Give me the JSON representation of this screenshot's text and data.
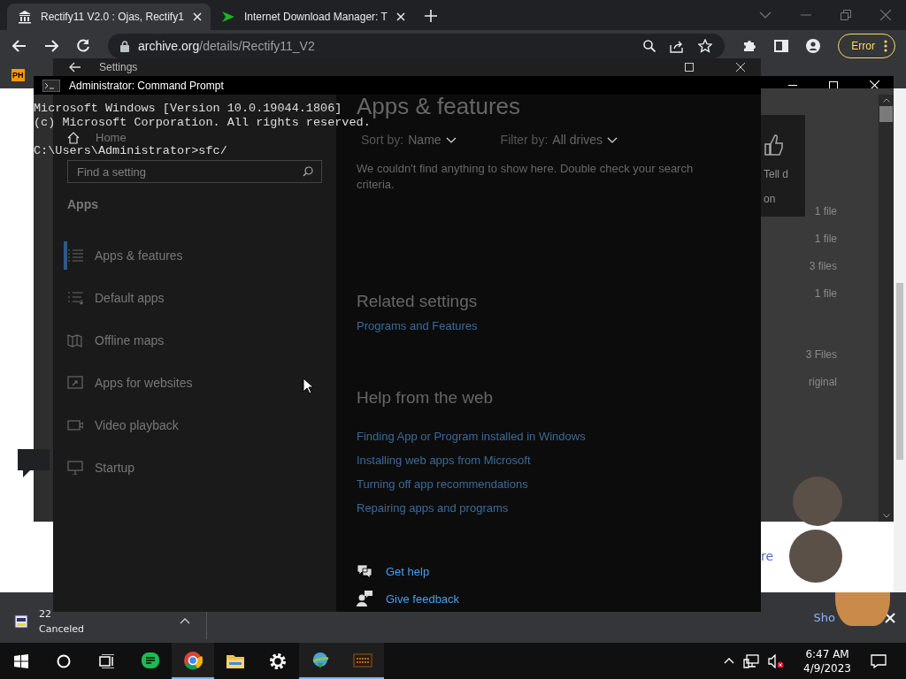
{
  "browser": {
    "tabs": [
      {
        "title": "Rectify11 V2.0 : Ojas, Rectify1",
        "selected": true
      },
      {
        "title": "Internet Download Manager: T",
        "selected": false
      }
    ],
    "address": {
      "host": "archive.org",
      "path": "/details/Rectify11_V2"
    },
    "profile_status": "Error",
    "bookmarks": [
      {
        "label": "PH"
      }
    ],
    "page": {
      "texts": [
        "Tell d",
        "on",
        "1 file",
        "1 file",
        "3 files",
        "1 file",
        "3 Files",
        "riginal",
        "re"
      ]
    },
    "downloads": [
      {
        "name": "22",
        "status": "Canceled"
      }
    ],
    "show_all": "Sho"
  },
  "settings": {
    "title": "Settings",
    "home": "Home",
    "search": {
      "placeholder": "Find a setting"
    },
    "section": "Apps",
    "nav": [
      {
        "label": "Apps & features",
        "selected": true
      },
      {
        "label": "Default apps",
        "selected": false
      },
      {
        "label": "Offline maps",
        "selected": false
      },
      {
        "label": "Apps for websites",
        "selected": false
      },
      {
        "label": "Video playback",
        "selected": false
      },
      {
        "label": "Startup",
        "selected": false
      }
    ],
    "heading": "Apps & features",
    "sort": {
      "label": "Sort by:",
      "value": "Name"
    },
    "filter": {
      "label": "Filter by:",
      "value": "All drives"
    },
    "message": "We couldn't find anything to show here. Double check your search criteria.",
    "related_heading": "Related settings",
    "related_links": [
      "Programs and Features"
    ],
    "help_heading": "Help from the web",
    "help_links": [
      "Finding App or Program installed in Windows",
      "Installing web apps from Microsoft",
      "Turning off app recommendations",
      "Repairing apps and programs"
    ],
    "actions": [
      {
        "label": "Get help"
      },
      {
        "label": "Give feedback"
      }
    ]
  },
  "cmd": {
    "title": "Administrator: Command Prompt",
    "banner": [
      "Microsoft Windows [Version 10.0.19044.1806]",
      "(c) Microsoft Corporation. All rights reserved."
    ],
    "prompt": "C:\\Users\\Administrator>sfc/"
  },
  "taskbar": {
    "apps": [
      {
        "active": false
      },
      {
        "active": true
      },
      {
        "active": false
      },
      {
        "active": false
      },
      {
        "active": true
      },
      {
        "active": true
      }
    ],
    "time": "6:47 AM",
    "date": "4/9/2023"
  }
}
